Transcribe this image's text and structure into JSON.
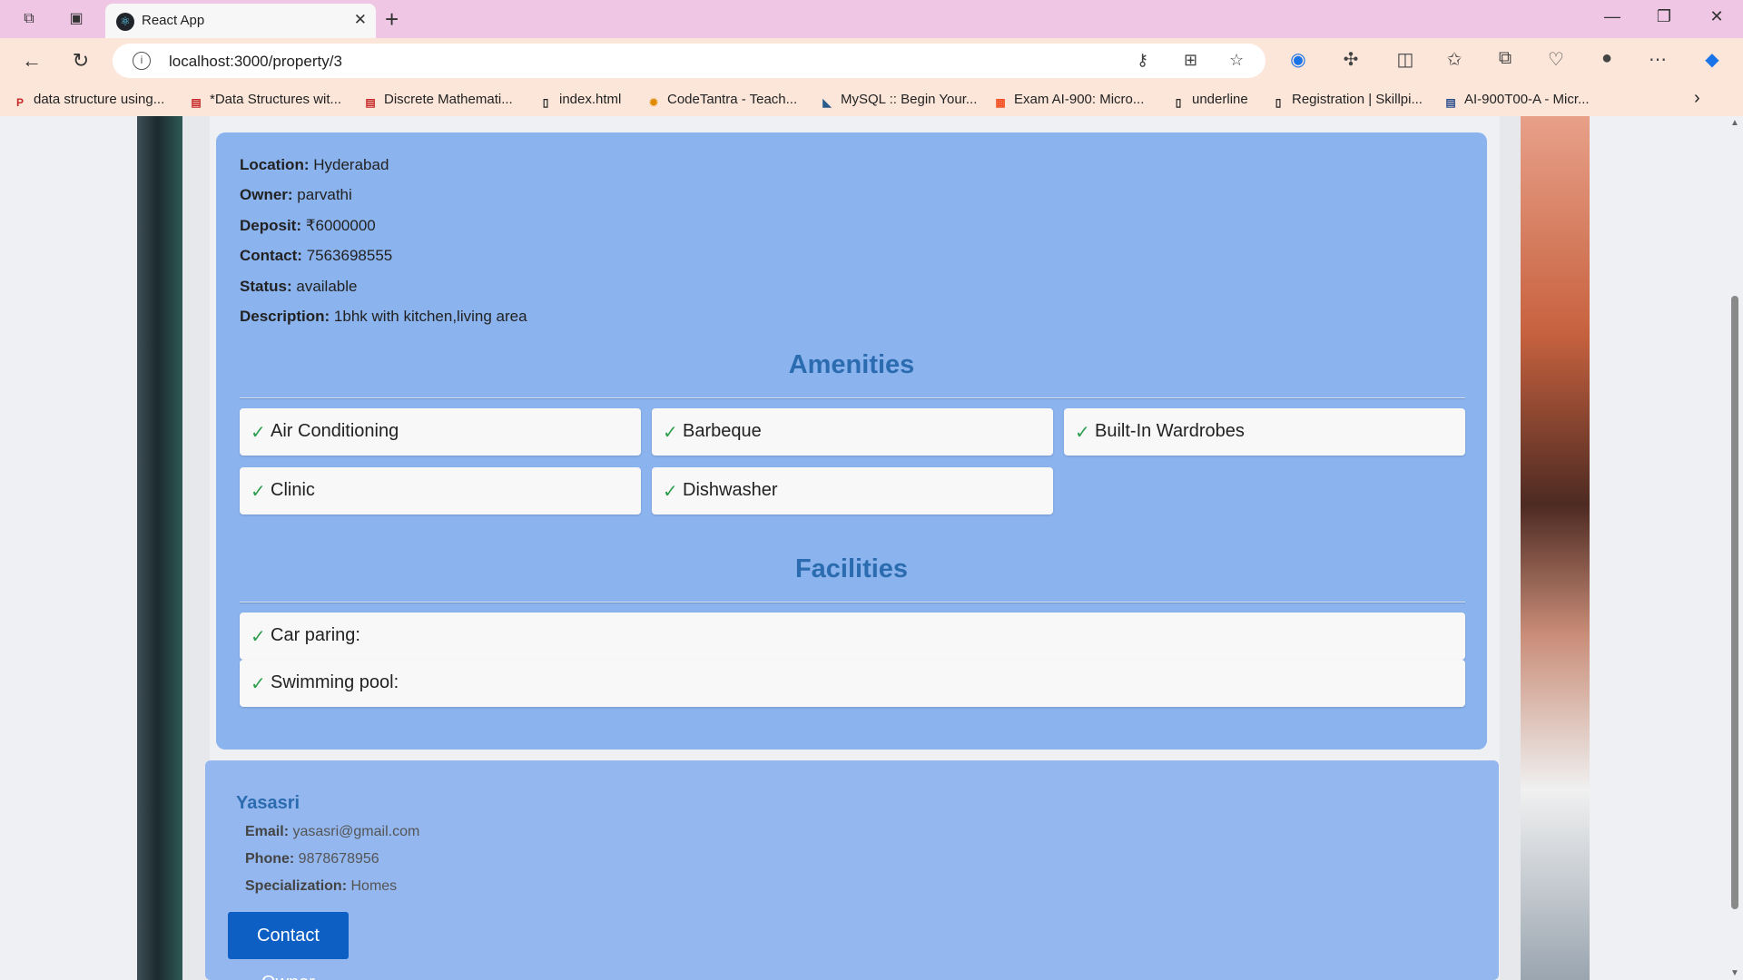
{
  "browser": {
    "tab_title": "React App",
    "url": "localhost:3000/property/3",
    "bookmarks": [
      {
        "label": "data structure using...",
        "icon": "pdf-icon"
      },
      {
        "label": "*Data Structures wit...",
        "icon": "pdf-icon"
      },
      {
        "label": "Discrete Mathemati...",
        "icon": "pdf-icon"
      },
      {
        "label": "index.html",
        "icon": "file-icon"
      },
      {
        "label": "CodeTantra - Teach...",
        "icon": "codetantra-icon"
      },
      {
        "label": "MySQL :: Begin Your...",
        "icon": "mysql-icon"
      },
      {
        "label": "Exam AI-900: Micro...",
        "icon": "microsoft-icon"
      },
      {
        "label": "underline",
        "icon": "file-icon"
      },
      {
        "label": "Registration | Skillpi...",
        "icon": "file-icon"
      },
      {
        "label": "AI-900T00-A - Micr...",
        "icon": "page-icon"
      }
    ]
  },
  "property": {
    "location_label": "Location:",
    "location": "Hyderabad",
    "owner_label": "Owner:",
    "owner": "parvathi",
    "deposit_label": "Deposit:",
    "deposit": "₹6000000",
    "contact_label": "Contact:",
    "contact": "7563698555",
    "status_label": "Status:",
    "status": "available",
    "description_label": "Description:",
    "description": "1bhk with kitchen,living area"
  },
  "amenities": {
    "title": "Amenities",
    "items": [
      "Air Conditioning",
      "Barbeque",
      "Built-In Wardrobes",
      "Clinic",
      "Dishwasher"
    ]
  },
  "facilities": {
    "title": "Facilities",
    "items": [
      "Car paring:",
      "Swimming pool:"
    ]
  },
  "owner_card": {
    "name": "Yasasri",
    "email_label": "Email:",
    "email": "yasasri@gmail.com",
    "phone_label": "Phone:",
    "phone": "9878678956",
    "specialization_label": "Specialization:",
    "specialization": "Homes",
    "button_label": "Contact Owner"
  },
  "check_mark": "✓",
  "colors": {
    "card_bg": "#8bb3ee",
    "heading": "#2b6cb0",
    "button": "#0d5fc4",
    "check": "#2e9e4f"
  }
}
